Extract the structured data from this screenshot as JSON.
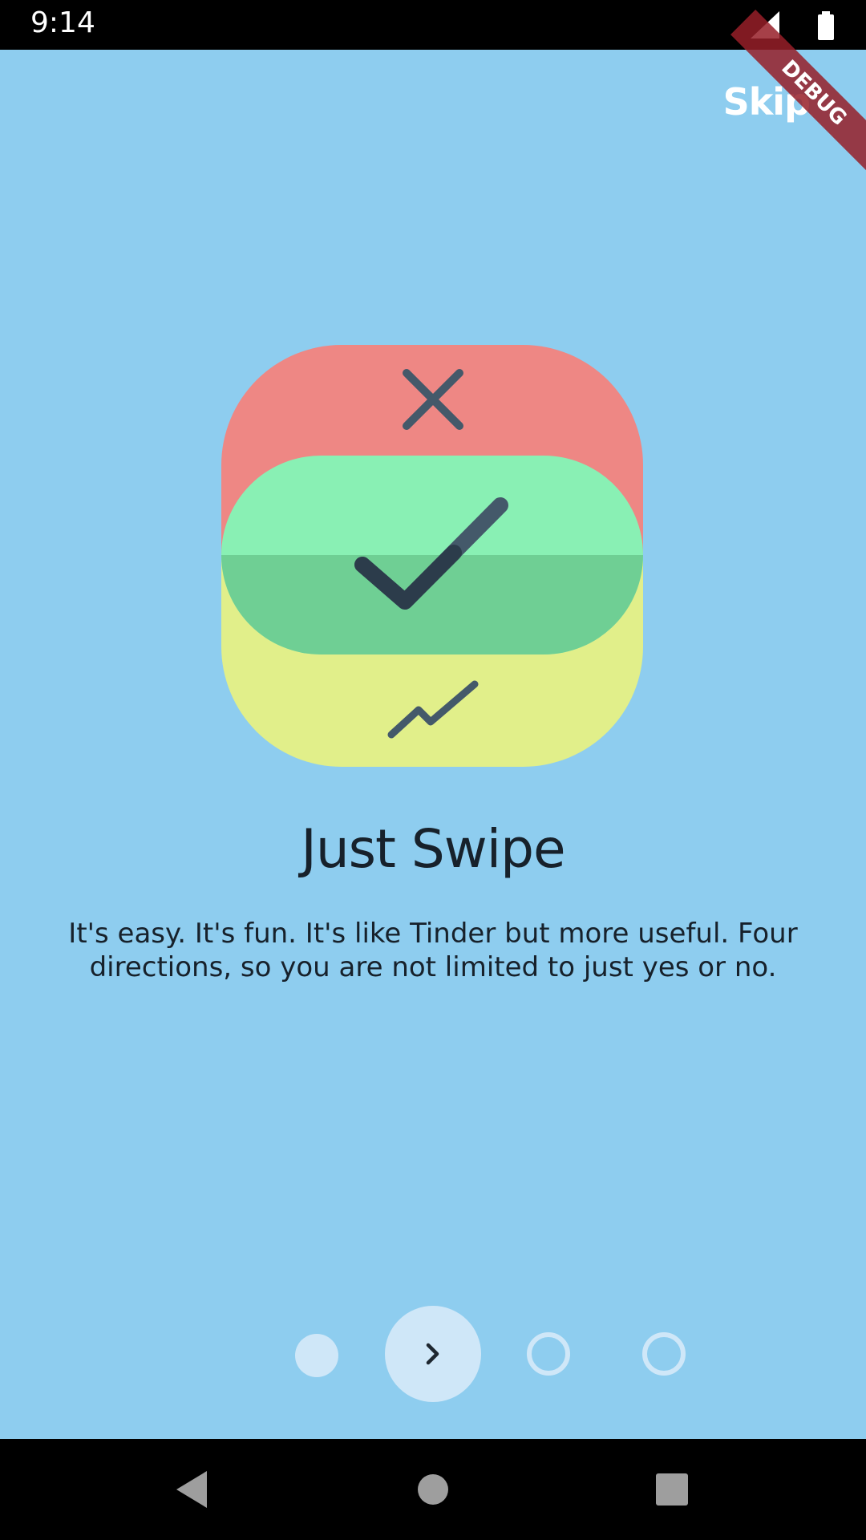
{
  "status_bar": {
    "time": "9:14",
    "icons": [
      "signal-icon",
      "battery-icon"
    ]
  },
  "header": {
    "skip_label": "Skip",
    "debug_label": "DEBUG"
  },
  "slide": {
    "title": "Just Swipe",
    "description": "It's easy. It's fun. It's like Tinder but more useful. Four directions, so you are not limited to just yes or no."
  },
  "pager": {
    "pages": 4,
    "current_page": 1,
    "next_icon": "chevron-right-icon"
  },
  "nav_bar": {
    "buttons": [
      "back-icon",
      "home-icon",
      "recents-icon"
    ]
  },
  "colors": {
    "background": "#8ecdef",
    "red_card": "#ee8784",
    "green_card": "#89f0b4",
    "yellow_card": "#e1ef8a",
    "icon_dark": "#2f3d4a",
    "dot": "#cfe7f8"
  }
}
